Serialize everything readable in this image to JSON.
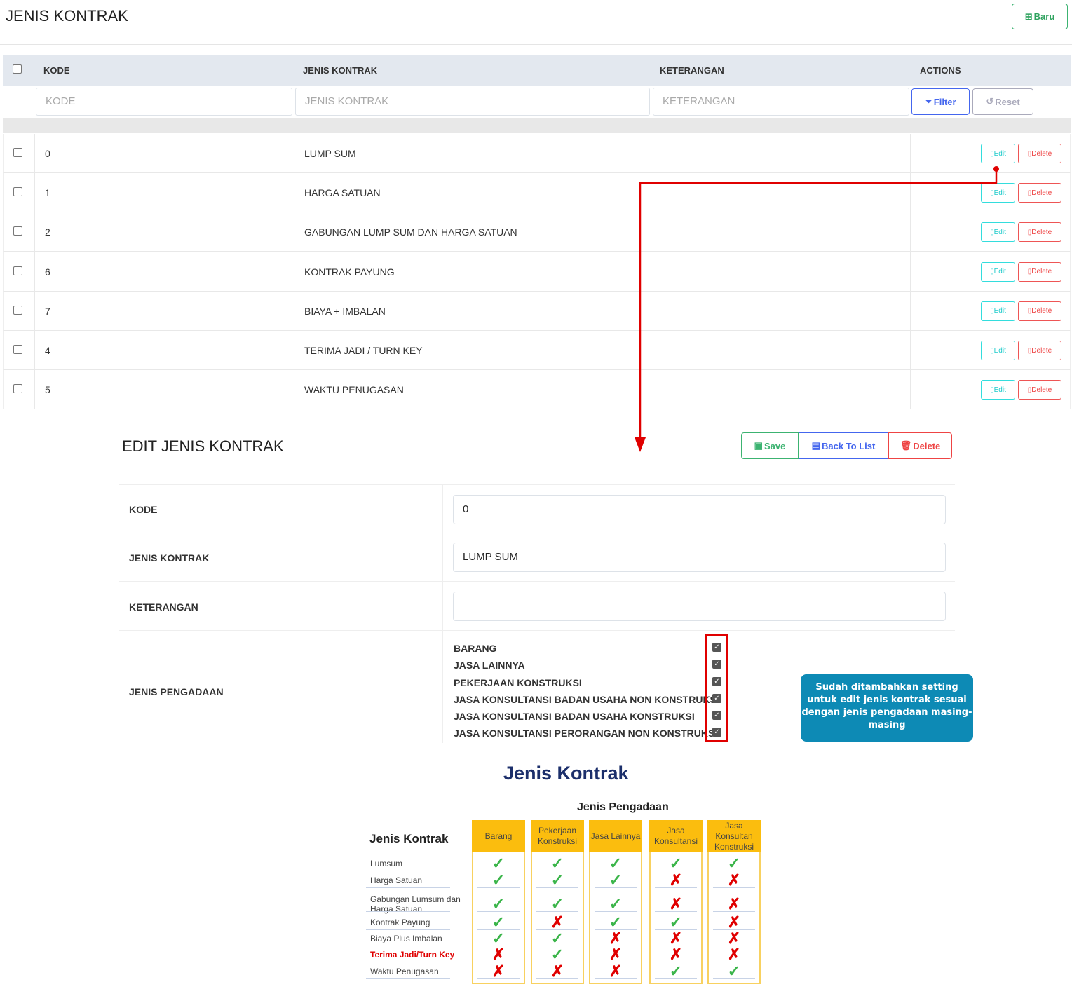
{
  "page": {
    "title": "JENIS KONTRAK",
    "new_button": "Baru"
  },
  "table": {
    "headers": [
      "KODE",
      "JENIS KONTRAK",
      "KETERANGAN",
      "ACTIONS"
    ],
    "filters": {
      "kode_placeholder": "KODE",
      "jenis_placeholder": "JENIS KONTRAK",
      "keterangan_placeholder": "KETERANGAN",
      "filter_label": "Filter",
      "reset_label": "Reset"
    },
    "edit_label": "Edit",
    "delete_label": "Delete",
    "rows": [
      {
        "kode": "0",
        "jenis": "LUMP SUM",
        "keterangan": ""
      },
      {
        "kode": "1",
        "jenis": "HARGA SATUAN",
        "keterangan": ""
      },
      {
        "kode": "2",
        "jenis": "GABUNGAN LUMP SUM DAN HARGA SATUAN",
        "keterangan": ""
      },
      {
        "kode": "6",
        "jenis": "KONTRAK PAYUNG",
        "keterangan": ""
      },
      {
        "kode": "7",
        "jenis": "BIAYA + IMBALAN",
        "keterangan": ""
      },
      {
        "kode": "4",
        "jenis": "TERIMA JADI / TURN KEY",
        "keterangan": ""
      },
      {
        "kode": "5",
        "jenis": "WAKTU PENUGASAN",
        "keterangan": ""
      }
    ]
  },
  "edit": {
    "title": "EDIT JENIS KONTRAK",
    "save": "Save",
    "back": "Back To List",
    "delete": "Delete",
    "fields": {
      "kode_label": "KODE",
      "kode_value": "0",
      "jenis_label": "JENIS KONTRAK",
      "jenis_value": "LUMP SUM",
      "keterangan_label": "KETERANGAN",
      "keterangan_value": "",
      "pengadaan_label": "JENIS PENGADAAN"
    },
    "pengadaan": [
      "BARANG",
      "JASA LAINNYA",
      "PEKERJAAN KONSTRUKSI",
      "JASA KONSULTANSI BADAN USAHA NON KONSTRUKSI",
      "JASA KONSULTANSI BADAN USAHA KONSTRUKSI",
      "JASA KONSULTANSI PERORANGAN NON KONSTRUKSI"
    ],
    "tooltip": "Sudah ditambahkan setting untuk edit jenis kontrak sesuai dengan jenis pengadaan masing-masing"
  },
  "matrix": {
    "title": "Jenis Kontrak",
    "subtitle": "Jenis Pengadaan",
    "row_header": "Jenis Kontrak",
    "columns": [
      "Barang",
      "Pekerjaan Konstruksi",
      "Jasa Lainnya",
      "Jasa Konsultansi",
      "Jasa Konsultan Konstruksi"
    ],
    "rows": [
      {
        "label": "Lumsum",
        "values": [
          true,
          true,
          true,
          true,
          true
        ]
      },
      {
        "label": "Harga Satuan",
        "values": [
          true,
          true,
          true,
          false,
          false
        ]
      },
      {
        "label": "Gabungan Lumsum dan Harga Satuan",
        "values": [
          true,
          true,
          true,
          false,
          false
        ]
      },
      {
        "label": "Kontrak Payung",
        "values": [
          true,
          false,
          true,
          true,
          false
        ]
      },
      {
        "label": "Biaya Plus Imbalan",
        "values": [
          true,
          true,
          false,
          false,
          false
        ]
      },
      {
        "label": "Terima Jadi/Turn Key",
        "values": [
          false,
          true,
          false,
          false,
          false
        ],
        "highlight": true
      },
      {
        "label": "Waktu Penugasan",
        "values": [
          false,
          false,
          false,
          true,
          true
        ]
      }
    ]
  },
  "colors": {
    "accent_red": "#e00000",
    "tooltip": "#0d8ab5",
    "matrix_header": "#fbbd0e"
  }
}
